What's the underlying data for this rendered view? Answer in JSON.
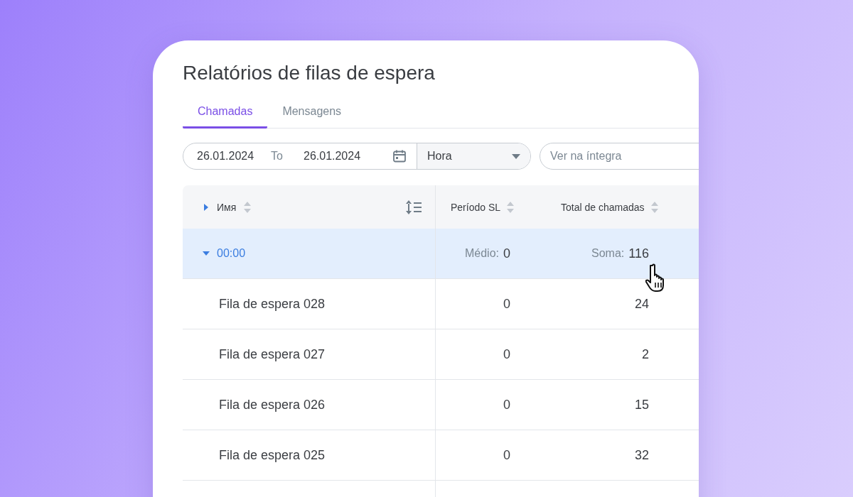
{
  "title": "Relatórios de filas de espera",
  "tabs": [
    {
      "label": "Chamadas",
      "selected": true
    },
    {
      "label": "Mensagens",
      "selected": false
    }
  ],
  "filters": {
    "date_from": "26.01.2024",
    "date_separator": "To",
    "date_to": "26.01.2024",
    "grouping": "Hora",
    "search": {
      "placeholder": "Ver na íntegra"
    }
  },
  "table": {
    "columns": [
      {
        "label": "Имя",
        "expanded": false
      },
      {
        "label": "Período SL"
      },
      {
        "label": "Total de chamadas"
      }
    ],
    "group": {
      "label": "00:00",
      "expanded": true,
      "selected": true,
      "avg_label": "Médio:",
      "avg": "0",
      "sum_label": "Soma:",
      "sum": "116"
    },
    "rows": [
      {
        "name": "Fila de espera 028",
        "sl": "0",
        "total": "24"
      },
      {
        "name": "Fila de espera 027",
        "sl": "0",
        "total": "2"
      },
      {
        "name": "Fila de espera 026",
        "sl": "0",
        "total": "15"
      },
      {
        "name": "Fila de espera 025",
        "sl": "0",
        "total": "32"
      }
    ]
  }
}
